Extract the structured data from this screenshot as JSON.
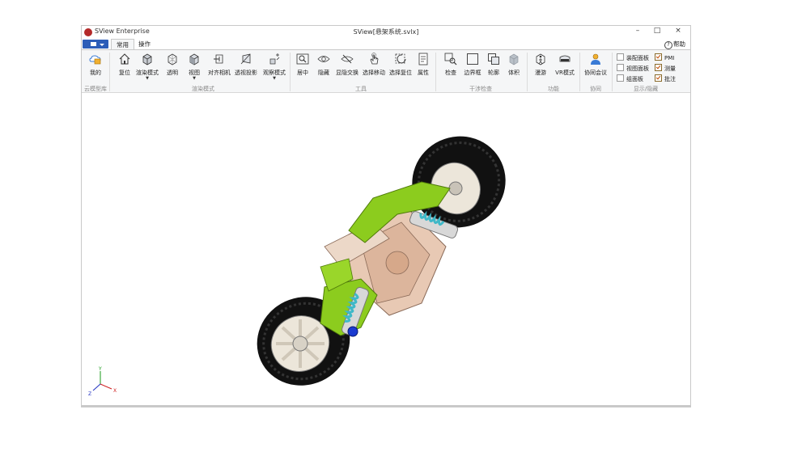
{
  "app": {
    "name": "SView Enterprise",
    "doc_title": "SView[悬架系统.svlx]"
  },
  "window_controls": {
    "minimize": "–",
    "maximize": "□",
    "close": "×"
  },
  "menu": {
    "tabs": [
      "常用",
      "操作"
    ],
    "active_tab": "常用",
    "help": "帮助",
    "help_glyph": "?"
  },
  "ribbon": {
    "groups": [
      {
        "label": "云模型库",
        "buttons": [
          {
            "label": "我的",
            "icon": "cloud-folder-icon"
          }
        ]
      },
      {
        "label": "渲染模式",
        "buttons": [
          {
            "label": "复位",
            "icon": "home-icon"
          },
          {
            "label": "渲染模式",
            "icon": "cube-render-icon",
            "dropdown": true
          },
          {
            "label": "透明",
            "icon": "cube-transparent-icon"
          },
          {
            "label": "视图",
            "icon": "cube-view-icon",
            "dropdown": true
          },
          {
            "label": "对齐相机",
            "icon": "align-camera-icon"
          },
          {
            "label": "透视投影",
            "icon": "perspective-icon"
          },
          {
            "label": "观察模式",
            "icon": "observe-mode-icon",
            "dropdown": true
          }
        ]
      },
      {
        "label": "工具",
        "buttons": [
          {
            "label": "居中",
            "icon": "center-icon"
          },
          {
            "label": "隐藏",
            "icon": "eye-icon"
          },
          {
            "label": "显隐交换",
            "icon": "eye-swap-icon"
          },
          {
            "label": "选择移动",
            "icon": "hand-move-icon"
          },
          {
            "label": "选择复位",
            "icon": "reset-selection-icon"
          },
          {
            "label": "属性",
            "icon": "properties-icon"
          }
        ]
      },
      {
        "label": "干涉检查",
        "buttons": [
          {
            "label": "检查",
            "icon": "inspect-icon"
          },
          {
            "label": "边界框",
            "icon": "bounding-box-icon"
          },
          {
            "label": "轮廓",
            "icon": "outline-icon"
          },
          {
            "label": "体积",
            "icon": "volume-icon"
          }
        ]
      },
      {
        "label": "功能",
        "buttons": [
          {
            "label": "漫游",
            "icon": "walkthrough-icon"
          },
          {
            "label": "VR模式",
            "icon": "vr-headset-icon"
          }
        ]
      },
      {
        "label": "协同",
        "buttons": [
          {
            "label": "协同会议",
            "icon": "meeting-icon"
          }
        ]
      },
      {
        "label": "显示/隐藏",
        "checkboxes": [
          {
            "label": "装配面板",
            "checked": false
          },
          {
            "label": "视图面板",
            "checked": false
          },
          {
            "label": "组面板",
            "checked": false
          },
          {
            "label": "PMI",
            "checked": true
          },
          {
            "label": "测量",
            "checked": true
          },
          {
            "label": "批注",
            "checked": true
          }
        ]
      }
    ]
  },
  "axis_triad": {
    "x": "X",
    "y": "Y",
    "z": "Z"
  }
}
